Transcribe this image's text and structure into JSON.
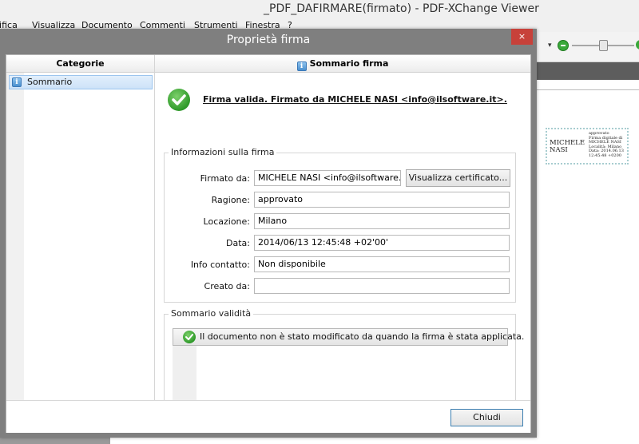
{
  "app": {
    "title": "_PDF_DAFIRMARE(firmato) - PDF-XChange Viewer",
    "menu": [
      "lifica",
      "Visualizza",
      "Documento",
      "Commenti",
      "Strumenti",
      "Finestra",
      "?"
    ]
  },
  "stamp": {
    "name_line1": "MICHELE",
    "name_line2": "NASI",
    "details": [
      "approvato",
      "Firma digitale di",
      "MICHELE NASI",
      "Località: Milano",
      "Data: 2014.06.13",
      "12:45:48 +0200"
    ]
  },
  "dialog": {
    "title": "Proprietà firma",
    "close_icon": "×",
    "left_header": "Categorie",
    "right_header": "Sommario firma",
    "tree_items": [
      {
        "label": "Sommario"
      }
    ],
    "valid_message": "Firma valida. Firmato da MICHELE NASI <info@ilsoftware.it>.",
    "info_group": {
      "legend": "Informazioni sulla firma",
      "fields": [
        {
          "label": "Firmato da:",
          "value": "MICHELE NASI <info@ilsoftware.it>"
        },
        {
          "label": "Ragione:",
          "value": "approvato"
        },
        {
          "label": "Locazione:",
          "value": "Milano"
        },
        {
          "label": "Data:",
          "value": "2014/06/13 12:45:48 +02'00'"
        },
        {
          "label": "Info contatto:",
          "value": "Non disponibile"
        },
        {
          "label": "Creato da:",
          "value": ""
        }
      ],
      "view_cert_button": "Visualizza certificato..."
    },
    "validity_group": {
      "legend": "Sommario validità",
      "message": "Il documento non è stato modificato da quando la firma è stata applicata."
    },
    "close_button": "Chiudi"
  },
  "colors": {
    "close_red": "#c7413a",
    "selection_blue": "#cde2f8",
    "check_green": "#2f9a2a"
  },
  "icons": {
    "info": "info-icon",
    "check": "check-circle-icon",
    "zoom_out": "zoom-out-icon",
    "zoom_in": "zoom-in-icon"
  }
}
